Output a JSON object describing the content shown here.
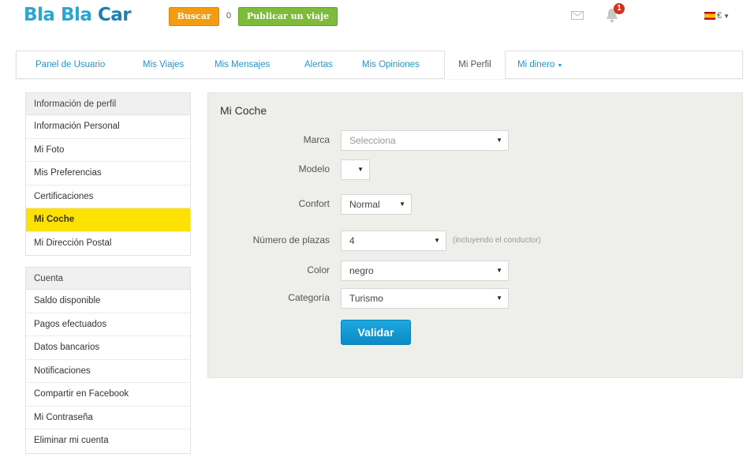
{
  "header": {
    "logo_bla": "Bla Bla",
    "logo_car": "Car",
    "search_label": "Buscar",
    "count": "0",
    "publish_label": "Publicar un viaje",
    "notification_count": "1",
    "currency": "€"
  },
  "tabs": [
    {
      "label": "Panel de Usuario"
    },
    {
      "label": "Mis Viajes"
    },
    {
      "label": "Mis Mensajes"
    },
    {
      "label": "Alertas"
    },
    {
      "label": "Mis Opiniones"
    },
    {
      "label": "Mi Perfil"
    },
    {
      "label": "Mi dinero"
    }
  ],
  "sidebar": {
    "profile": {
      "title": "Información de perfil",
      "items": [
        {
          "label": "Información Personal"
        },
        {
          "label": "Mi Foto"
        },
        {
          "label": "Mis Preferencias"
        },
        {
          "label": "Certificaciones"
        },
        {
          "label": "Mi Coche"
        },
        {
          "label": "Mi Dirección Postal"
        }
      ]
    },
    "account": {
      "title": "Cuenta",
      "items": [
        {
          "label": "Saldo disponible"
        },
        {
          "label": "Pagos efectuados"
        },
        {
          "label": "Datos bancarios"
        },
        {
          "label": "Notificaciones"
        },
        {
          "label": "Compartir en Facebook"
        },
        {
          "label": "Mi Contraseña"
        },
        {
          "label": "Eliminar mi cuenta"
        }
      ]
    }
  },
  "form": {
    "title": "Mi Coche",
    "marca_label": "Marca",
    "marca_value": "Selecciona",
    "modelo_label": "Modelo",
    "modelo_value": "",
    "confort_label": "Confort",
    "confort_value": "Normal",
    "plazas_label": "Número de plazas",
    "plazas_value": "4",
    "plazas_hint": "(incluyendo el conductor)",
    "color_label": "Color",
    "color_value": "negro",
    "categoria_label": "Categoría",
    "categoria_value": "Turismo",
    "submit_label": "Validar"
  },
  "colors": {
    "brand_blue": "#2aa6cf",
    "search_orange": "#f39c12",
    "publish_green": "#7dbb3a",
    "active_yellow": "#fde100",
    "validate_blue": "#1ea8e0"
  },
  "icons": {
    "mail": "mail-icon",
    "bell": "bell-icon",
    "flag": "spain-flag-icon",
    "caret": "caret-down-icon"
  }
}
